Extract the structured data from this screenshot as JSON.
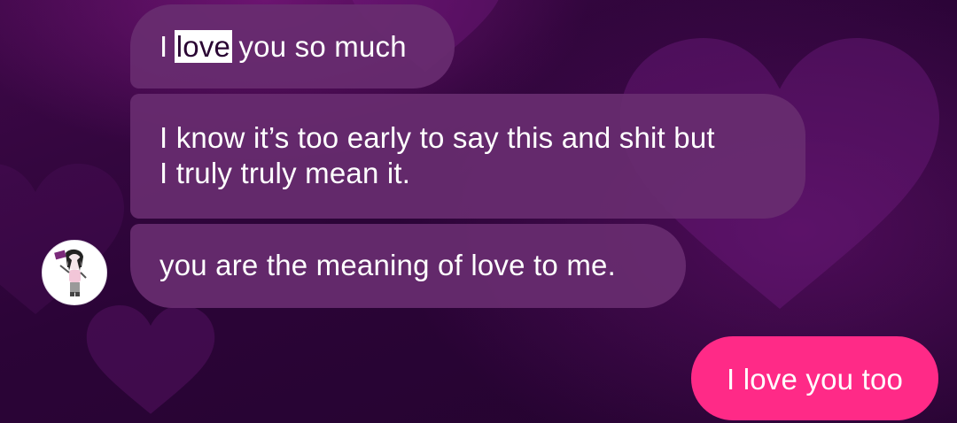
{
  "colors": {
    "background": "#2b0437",
    "incoming_bubble": "#682c70",
    "outgoing_bubble": "#ff2a87",
    "text": "#ffffff"
  },
  "messages": [
    {
      "direction": "incoming",
      "before": "I ",
      "highlight": "love",
      "after": " you so much"
    },
    {
      "direction": "incoming",
      "lines": [
        "I know it’s too early to say this and shit but",
        "I truly truly mean it."
      ]
    },
    {
      "direction": "incoming",
      "text": "you are the meaning of love to me."
    },
    {
      "direction": "outgoing",
      "text": "I love you too"
    }
  ],
  "avatar": {
    "icon": "cartoon-character-avatar-icon"
  }
}
